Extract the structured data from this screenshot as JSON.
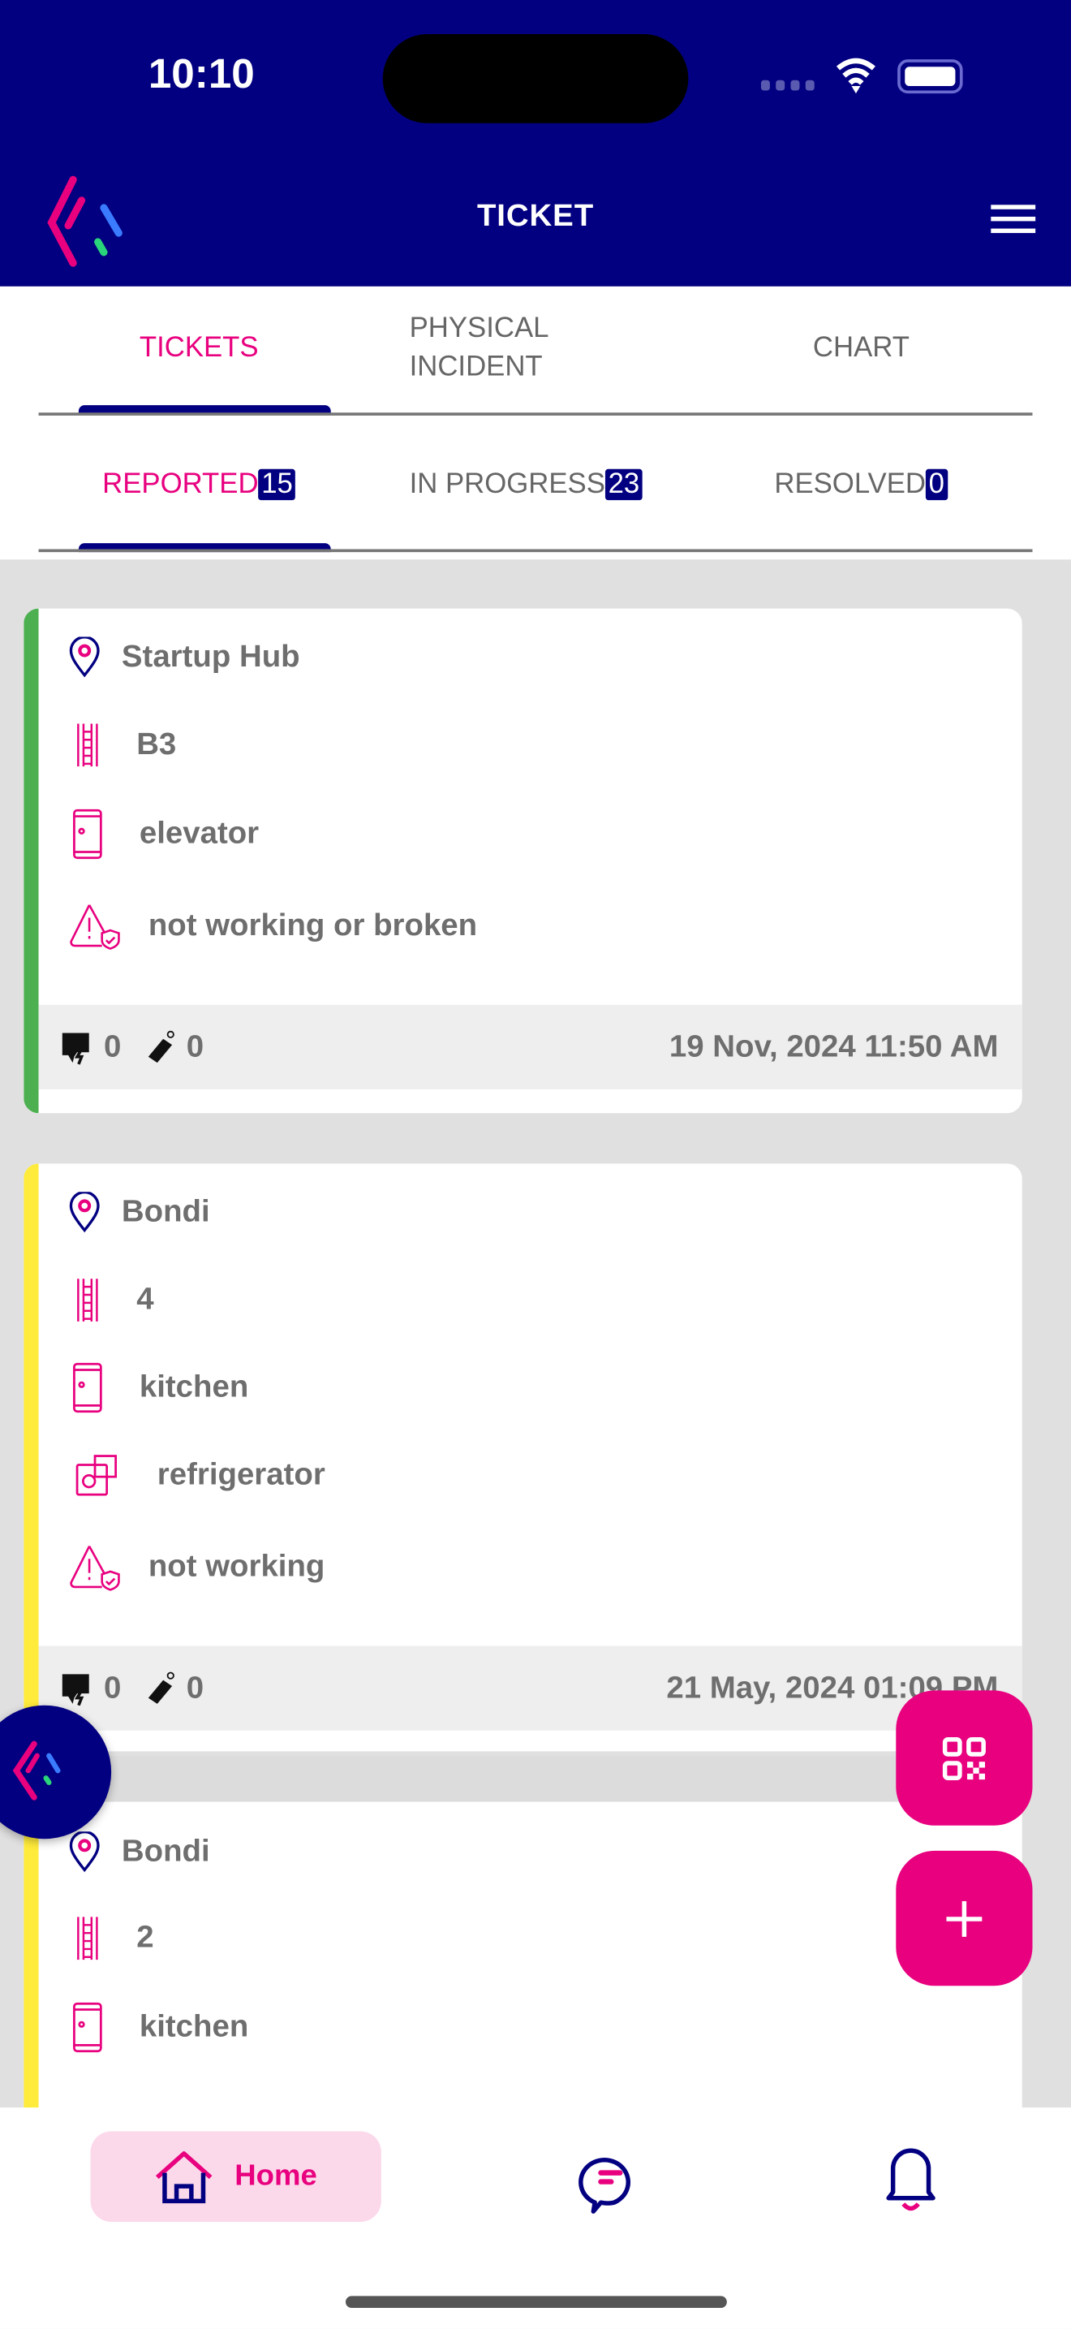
{
  "status_bar": {
    "time": "10:10"
  },
  "header": {
    "title": "TICKET"
  },
  "tabs": [
    {
      "label": "TICKETS",
      "active": true
    },
    {
      "label": "PHYSICAL INCIDENT"
    },
    {
      "label": "CHART"
    }
  ],
  "subtabs": [
    {
      "label": "REPORTED",
      "count": "15",
      "active": true
    },
    {
      "label": "IN PROGRESS",
      "count": "23"
    },
    {
      "label": "RESOLVED",
      "count": "0"
    }
  ],
  "colors": {
    "brand_navy": "#020080",
    "accent": "#e8007f",
    "status_green": "#4caf50",
    "status_yellow": "#ffeb3b"
  },
  "tickets": [
    {
      "location": "Startup Hub",
      "floor": "B3",
      "asset": "elevator",
      "issue": "not working or broken",
      "comments": "0",
      "tags": "0",
      "date": "19 Nov, 2024 11:50 AM",
      "status_color": "#4caf50"
    },
    {
      "location": "Bondi",
      "floor": "4",
      "asset": "kitchen",
      "sub_asset": "refrigerator",
      "issue": "not working",
      "comments": "0",
      "tags": "0",
      "date": "21 May, 2024 01:09 PM",
      "status_color": "#ffeb3b"
    },
    {
      "location": "Bondi",
      "floor": "2",
      "asset": "kitchen",
      "status_color": "#ffeb3b"
    }
  ],
  "bottom_nav": {
    "home": "Home"
  }
}
